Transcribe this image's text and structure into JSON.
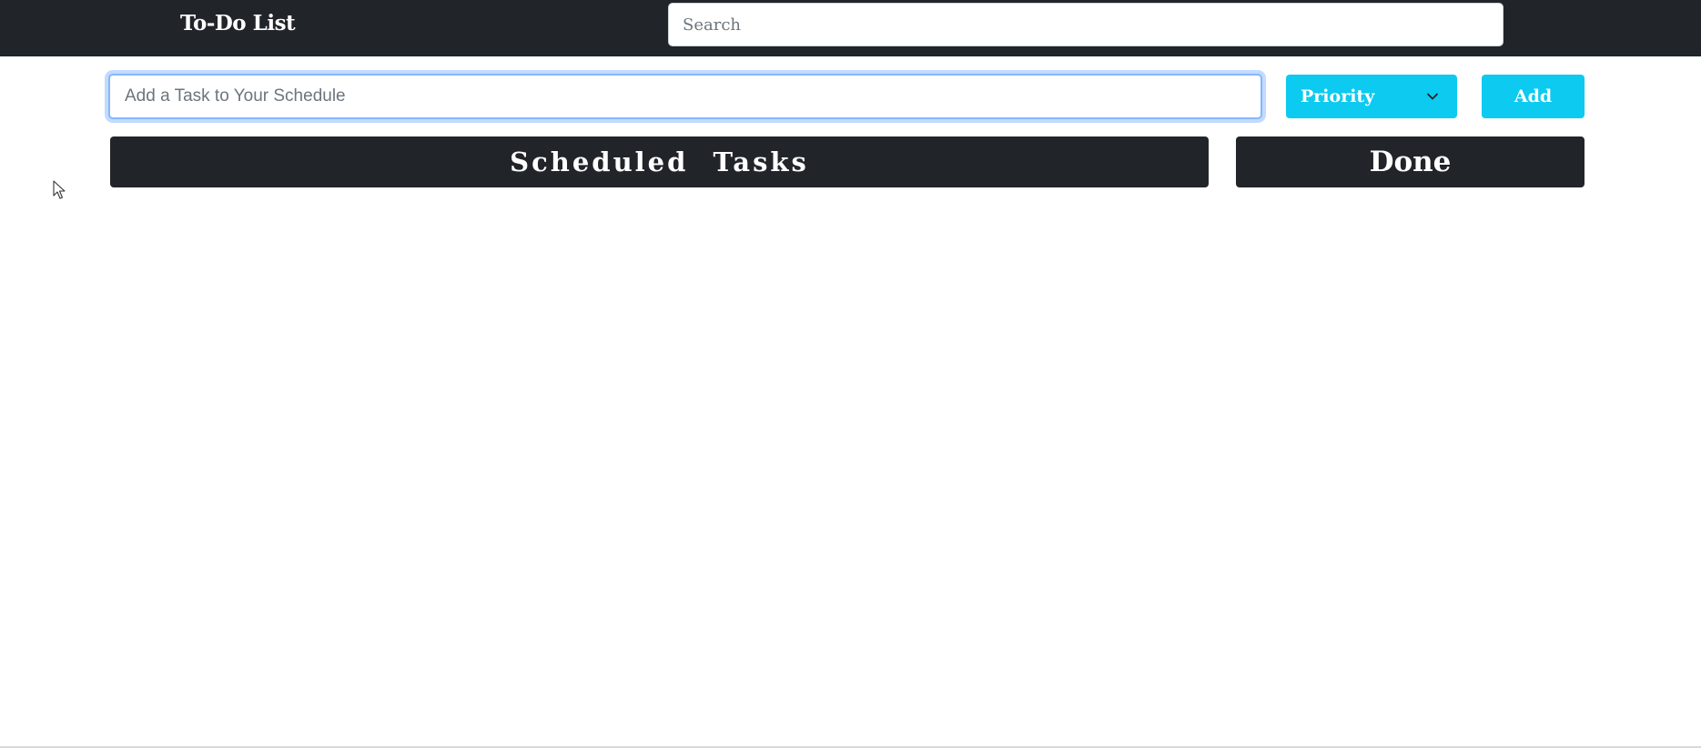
{
  "navbar": {
    "brand": "To-Do List",
    "search_placeholder": "Search",
    "search_value": ""
  },
  "task_form": {
    "task_placeholder": "Add a Task to Your Schedule",
    "task_value": "",
    "priority_label": "Priority",
    "add_label": "Add"
  },
  "columns": {
    "scheduled_title": "Scheduled Tasks",
    "done_title": "Done"
  },
  "colors": {
    "navbar_bg": "#212529",
    "accent": "#0dcaf0",
    "focus_border": "#86b7fe"
  },
  "icons": {
    "dropdown": "chevron-down-icon",
    "cursor": "mouse-pointer-icon"
  }
}
